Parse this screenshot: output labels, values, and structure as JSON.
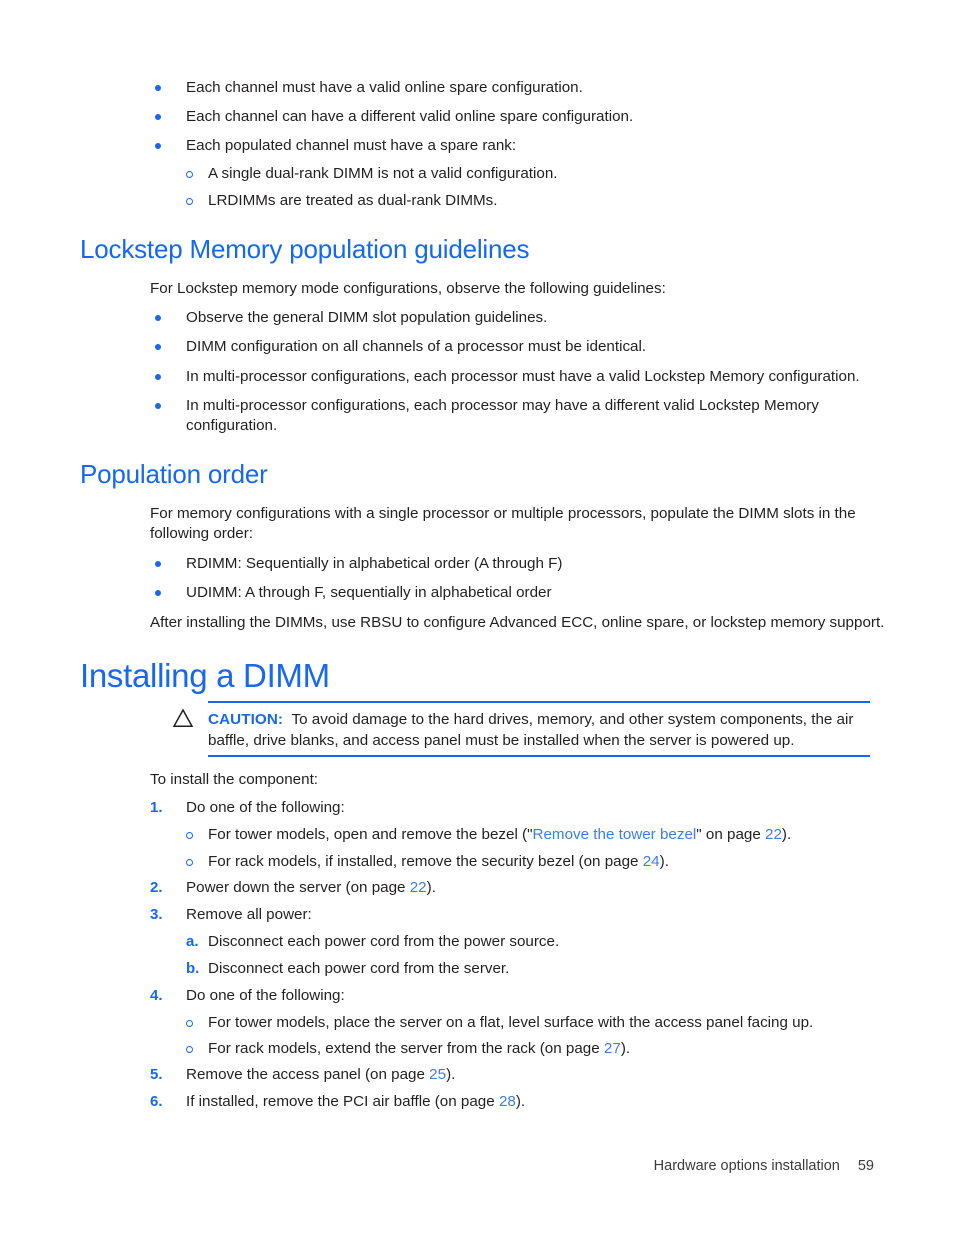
{
  "intro_bullets": [
    {
      "text": "Each channel must have a valid online spare configuration."
    },
    {
      "text": "Each channel can have a different valid online spare configuration."
    },
    {
      "text": "Each populated channel must have a spare rank:"
    }
  ],
  "intro_subbullets": [
    {
      "text": "A single dual-rank DIMM is not a valid configuration."
    },
    {
      "text": "LRDIMMs are treated as dual-rank DIMMs."
    }
  ],
  "lockstep": {
    "heading": "Lockstep Memory population guidelines",
    "intro": "For Lockstep memory mode configurations, observe the following guidelines:",
    "bullets": [
      {
        "text": "Observe the general DIMM slot population guidelines."
      },
      {
        "text": "DIMM configuration on all channels of a processor must be identical."
      },
      {
        "text": "In multi-processor configurations, each processor must have a valid Lockstep Memory configuration."
      },
      {
        "text": "In multi-processor configurations, each processor may have a different valid Lockstep Memory configuration."
      }
    ]
  },
  "population": {
    "heading": "Population order",
    "intro": "For memory configurations with a single processor or multiple processors, populate the DIMM slots in the following order:",
    "bullets": [
      {
        "text": "RDIMM: Sequentially in alphabetical order (A through F)"
      },
      {
        "text": "UDIMM: A through F, sequentially in alphabetical order"
      }
    ],
    "outro": "After installing the DIMMs, use RBSU to configure Advanced ECC, online spare, or lockstep memory support."
  },
  "installing": {
    "heading": "Installing a DIMM",
    "caution": {
      "icon": "warning-triangle-icon",
      "label": "CAUTION:",
      "text": "To avoid damage to the hard drives, memory, and other system components, the air baffle, drive blanks, and access panel must be installed when the server is powered up."
    },
    "lead_in": "To install the component:",
    "steps": [
      {
        "num": "1.",
        "text": "Do one of the following:",
        "subs": [
          {
            "marker": "o",
            "pre": "For tower models, open and remove the bezel (\"",
            "link": "Remove the tower bezel",
            "mid": "\" on page ",
            "page": "22",
            "post": ")."
          },
          {
            "marker": "o",
            "pre": "For rack models, if installed, remove the security bezel (on page ",
            "link": "",
            "mid": "",
            "page": "24",
            "post": ")."
          }
        ]
      },
      {
        "num": "2.",
        "pre": "Power down the server (on page ",
        "page": "22",
        "post": ").",
        "subs": []
      },
      {
        "num": "3.",
        "text": "Remove all power:",
        "letter_subs": [
          {
            "marker": "a.",
            "text": "Disconnect each power cord from the power source."
          },
          {
            "marker": "b.",
            "text": "Disconnect each power cord from the server."
          }
        ]
      },
      {
        "num": "4.",
        "text": "Do one of the following:",
        "subs": [
          {
            "marker": "o",
            "pre": "For tower models, place the server on a flat, level surface with the access panel facing up.",
            "link": "",
            "mid": "",
            "page": "",
            "post": ""
          },
          {
            "marker": "o",
            "pre": "For rack models, extend the server from the rack (on page ",
            "link": "",
            "mid": "",
            "page": "27",
            "post": ")."
          }
        ]
      },
      {
        "num": "5.",
        "pre": "Remove the access panel (on page ",
        "page": "25",
        "post": ").",
        "subs": []
      },
      {
        "num": "6.",
        "pre": "If installed, remove the PCI air baffle (on page ",
        "page": "28",
        "post": ").",
        "subs": []
      }
    ]
  },
  "footer": {
    "title": "Hardware options installation",
    "page_number": "59"
  },
  "colors": {
    "heading_blue": "#1568ef",
    "link_blue": "#3a7fe8",
    "body_black": "#231f20"
  }
}
